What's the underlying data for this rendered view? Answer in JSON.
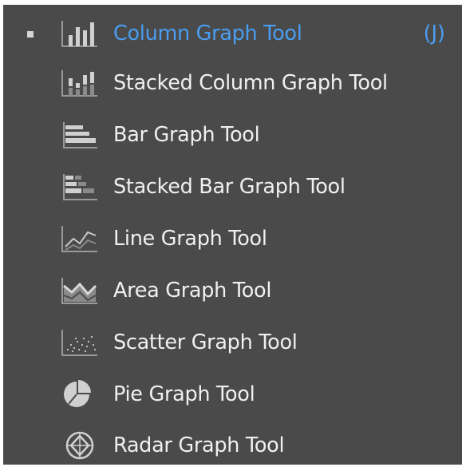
{
  "menu": {
    "items": [
      {
        "label": "Column Graph Tool",
        "shortcut": "(J)",
        "icon": "column-graph-icon",
        "active": true
      },
      {
        "label": "Stacked Column Graph Tool",
        "icon": "stacked-column-graph-icon"
      },
      {
        "label": "Bar Graph Tool",
        "icon": "bar-graph-icon"
      },
      {
        "label": "Stacked Bar Graph Tool",
        "icon": "stacked-bar-graph-icon"
      },
      {
        "label": "Line Graph Tool",
        "icon": "line-graph-icon"
      },
      {
        "label": "Area Graph Tool",
        "icon": "area-graph-icon"
      },
      {
        "label": "Scatter Graph Tool",
        "icon": "scatter-graph-icon"
      },
      {
        "label": "Pie Graph Tool",
        "icon": "pie-graph-icon"
      },
      {
        "label": "Radar Graph Tool",
        "icon": "radar-graph-icon"
      }
    ]
  },
  "colors": {
    "panel_background": "#4a4a4a",
    "text": "#f0f0f0",
    "active_text": "#4a9df0",
    "icon": "#d0d0d0"
  }
}
